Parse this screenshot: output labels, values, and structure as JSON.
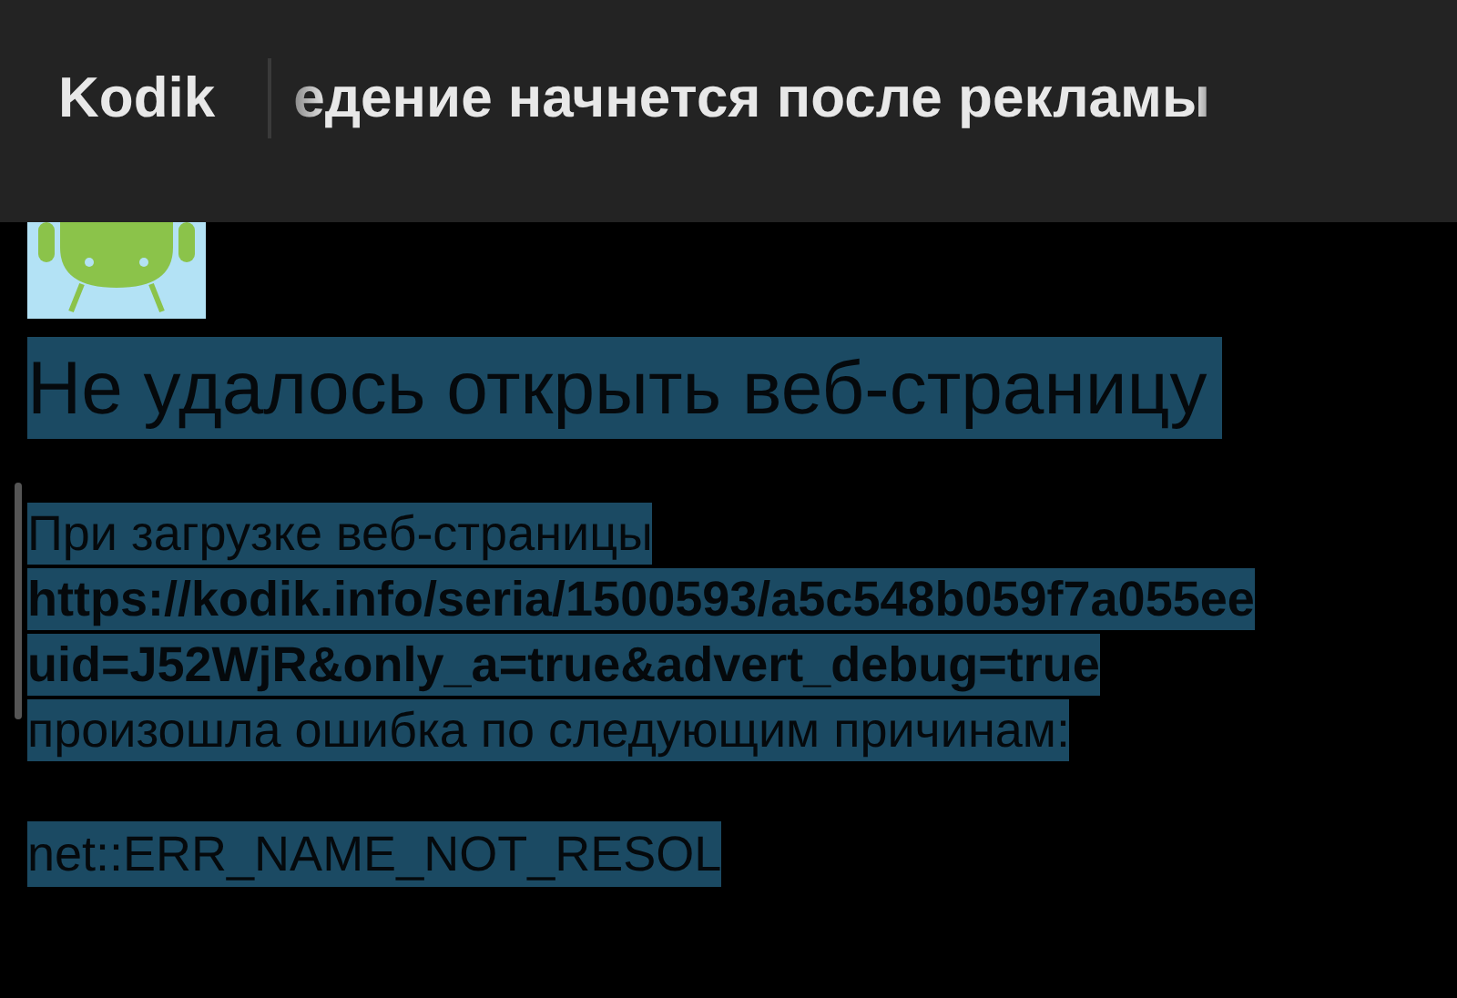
{
  "app_bar": {
    "app_name": "Kodik",
    "title": "едение начнется после рекламы"
  },
  "error_page": {
    "text_selected": true,
    "heading": "Не удалось открыть веб-страницу",
    "message_lines": [
      {
        "kind": "plain",
        "text": "При загрузке веб-страницы"
      },
      {
        "kind": "url",
        "text": "https://kodik.info/seria/1500593/a5c548b059f7a055ee"
      },
      {
        "kind": "url",
        "text": "uid=J52WjR&only_a=true&advert_debug=true"
      },
      {
        "kind": "plain",
        "text": "произошла ошибка по следующим причинам:"
      }
    ],
    "error_code": "net::ERR_NAME_NOT_RESOL"
  }
}
